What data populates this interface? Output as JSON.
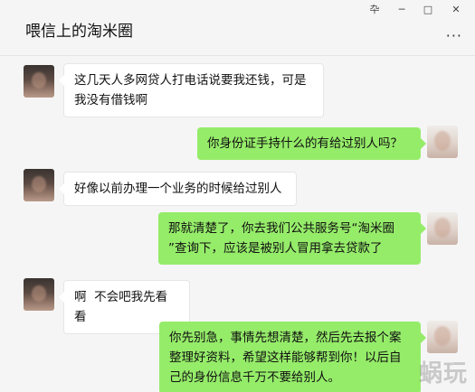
{
  "header": {
    "title": "喂信上的淘米圈",
    "window_controls": [
      "卆",
      "─",
      "□",
      "✕"
    ],
    "more_glyph": "···"
  },
  "messages": [
    {
      "side": "left",
      "text": "这几天人多网贷人打电话说要我还钱，可是\n我没有借钱啊"
    },
    {
      "side": "right",
      "text": "你身份证手持什么的有给过别人吗？"
    },
    {
      "side": "left",
      "text": "好像以前办理一个业务的时候给过别人"
    },
    {
      "side": "right",
      "text": "那就清楚了，你去我们公共服务号“淘米圈\n”查询下，应该是被别人冒用拿去贷款了"
    },
    {
      "side": "left",
      "text": "啊  不会吧我先看看"
    },
    {
      "side": "right",
      "text": "你先别急，事情先想清楚，然后先去报个案\n整理好资料，希望这样能够帮到你！以后自\n己的身份信息千万不要给别人。"
    }
  ],
  "watermark": "蜗玩",
  "colors": {
    "background": "#f5f5f5",
    "bubble_left": "#ffffff",
    "bubble_right": "#95ec69"
  }
}
